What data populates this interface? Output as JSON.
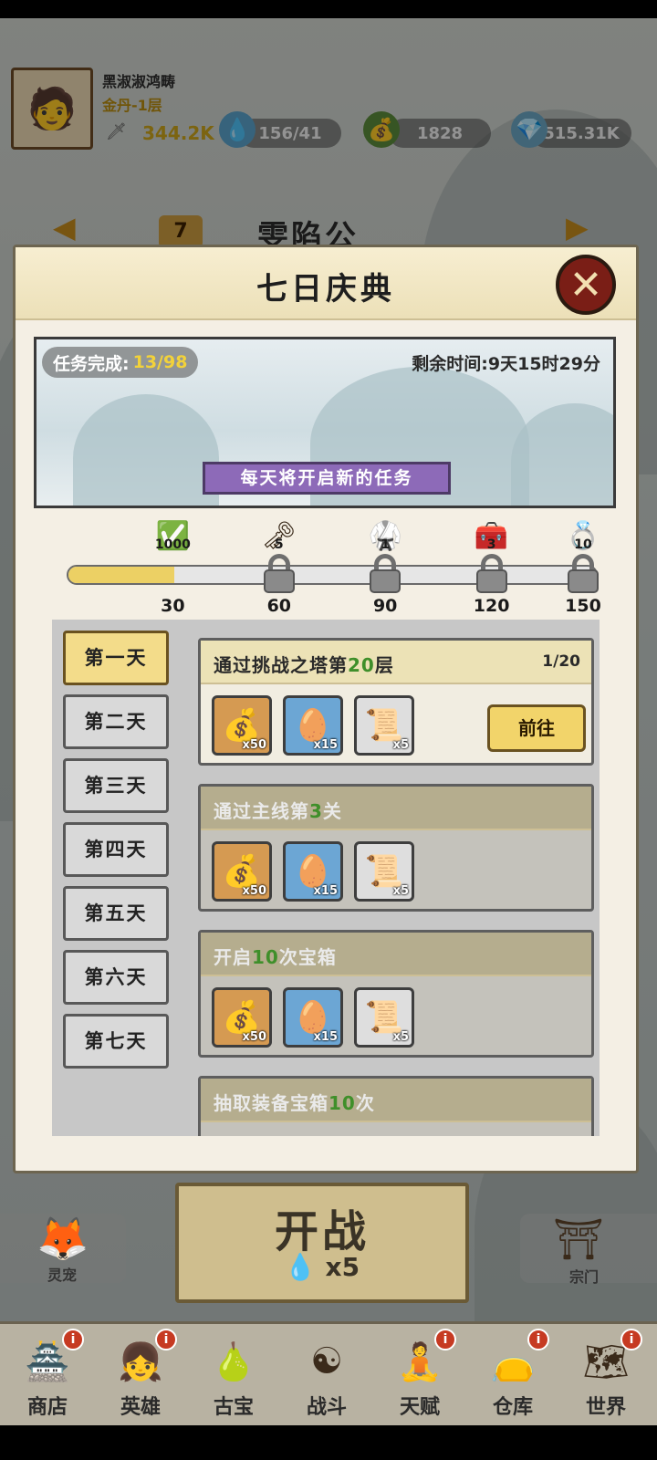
{
  "player": {
    "name": "黑淑淑鸿畴",
    "rank": "金丹-1层",
    "power": "344.2K",
    "resources": [
      {
        "icon": "water-drop-icon",
        "value": "156/41"
      },
      {
        "icon": "jade-bag-icon",
        "value": "1828"
      },
      {
        "icon": "crystal-icon",
        "value": "515.31K"
      }
    ]
  },
  "stage": {
    "number": "7",
    "title": "雯陷公"
  },
  "modal": {
    "title": "七日庆典",
    "task_done_label": "任务完成:",
    "task_done_value": "13/98",
    "time_left": "剩余时间:9天15时29分",
    "daily_tip": "每天将开启新的任务"
  },
  "progress": {
    "current": 30,
    "max": 150,
    "milestones": [
      {
        "icon": "checkmark-bundle-icon",
        "qty": "1000",
        "label": "30",
        "locked": false
      },
      {
        "icon": "purple-key-icon",
        "qty": "5",
        "label": "60",
        "locked": true
      },
      {
        "icon": "robe-icon",
        "qty": "1",
        "label": "90",
        "locked": true
      },
      {
        "icon": "purple-chest-icon",
        "qty": "3",
        "label": "120",
        "locked": true
      },
      {
        "icon": "ring-icon",
        "qty": "10",
        "label": "150",
        "locked": true
      }
    ]
  },
  "days": [
    "第一天",
    "第二天",
    "第三天",
    "第四天",
    "第五天",
    "第六天",
    "第七天"
  ],
  "active_day": 0,
  "tasks": [
    {
      "name_pre": "通过挑战之塔第",
      "name_num": "20",
      "name_post": "层",
      "progress": "1/20",
      "locked": false,
      "button": "前往",
      "rewards": [
        {
          "icon": "jade-bag-icon",
          "qty": "x50",
          "color": "orange"
        },
        {
          "icon": "spotted-egg-icon",
          "qty": "x15",
          "color": "blue"
        },
        {
          "icon": "scroll-icon",
          "qty": "x5",
          "color": "white"
        }
      ]
    },
    {
      "name_pre": "通过主线第",
      "name_num": "3",
      "name_post": "关",
      "progress": "",
      "locked": true,
      "button": "",
      "rewards": [
        {
          "icon": "jade-bag-icon",
          "qty": "x50",
          "color": "orange"
        },
        {
          "icon": "spotted-egg-icon",
          "qty": "x15",
          "color": "blue"
        },
        {
          "icon": "scroll-icon",
          "qty": "x5",
          "color": "white"
        }
      ]
    },
    {
      "name_pre": "开启",
      "name_num": "10",
      "name_post": "次宝箱",
      "progress": "",
      "locked": true,
      "button": "",
      "rewards": [
        {
          "icon": "jade-bag-icon",
          "qty": "x50",
          "color": "orange"
        },
        {
          "icon": "spotted-egg-icon",
          "qty": "x15",
          "color": "blue"
        },
        {
          "icon": "scroll-icon",
          "qty": "x5",
          "color": "white"
        }
      ]
    },
    {
      "name_pre": "抽取装备宝箱",
      "name_num": "10",
      "name_post": "次",
      "progress": "",
      "locked": true,
      "button": "",
      "rewards": []
    }
  ],
  "bottom": {
    "pet_label": "灵宠",
    "fight_label": "开战",
    "fight_cost": "x5",
    "sect_label": "宗门"
  },
  "nav": [
    {
      "label": "商店",
      "icon": "shop-icon",
      "badge": "i"
    },
    {
      "label": "英雄",
      "icon": "hero-icon",
      "badge": "i"
    },
    {
      "label": "古宝",
      "icon": "gourd-icon",
      "badge": ""
    },
    {
      "label": "战斗",
      "icon": "yin-yang-icon",
      "badge": ""
    },
    {
      "label": "天赋",
      "icon": "meditation-icon",
      "badge": "i"
    },
    {
      "label": "仓库",
      "icon": "sack-icon",
      "badge": "i"
    },
    {
      "label": "世界",
      "icon": "world-map-icon",
      "badge": "i"
    }
  ]
}
